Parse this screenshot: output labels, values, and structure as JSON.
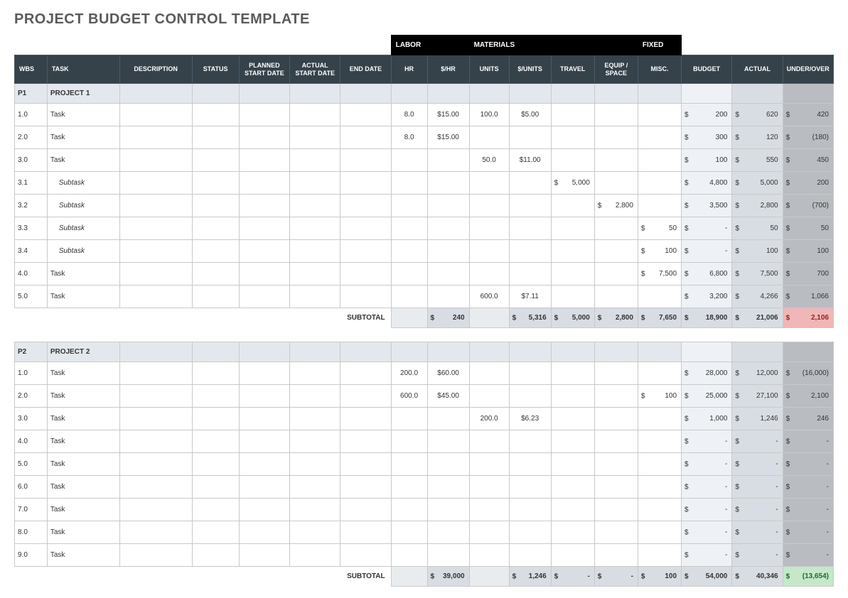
{
  "title": "PROJECT BUDGET CONTROL TEMPLATE",
  "cat": {
    "labor": "LABOR",
    "materials": "MATERIALS",
    "fixed": "FIXED"
  },
  "headers": {
    "wbs": "WBS",
    "task": "TASK",
    "description": "DESCRIPTION",
    "status": "STATUS",
    "pstart": "PLANNED START DATE",
    "astart": "ACTUAL START DATE",
    "end": "END DATE",
    "hr": "HR",
    "rhr": "$/HR",
    "units": "UNITS",
    "runits": "$/UNITS",
    "travel": "TRAVEL",
    "equip": "EQUIP / SPACE",
    "misc": "MISC.",
    "budget": "BUDGET",
    "actual": "ACTUAL",
    "uo": "UNDER/OVER"
  },
  "subtotalLabel": "SUBTOTAL",
  "dollarSign": "$",
  "projects": [
    {
      "id": "P1",
      "name": "PROJECT 1",
      "rows": [
        {
          "wbs": "1.0",
          "task": "Task",
          "hr": "8.0",
          "rhr": "$15.00",
          "units": "100.0",
          "runits": "$5.00",
          "travel": "",
          "equip": "",
          "misc": "",
          "budget": "200",
          "actual": "620",
          "uo": "420"
        },
        {
          "wbs": "2.0",
          "task": "Task",
          "hr": "8.0",
          "rhr": "$15.00",
          "units": "",
          "runits": "",
          "travel": "",
          "equip": "",
          "misc": "",
          "budget": "300",
          "actual": "120",
          "uo": "(180)"
        },
        {
          "wbs": "3.0",
          "task": "Task",
          "hr": "",
          "rhr": "",
          "units": "50.0",
          "runits": "$11.00",
          "travel": "",
          "equip": "",
          "misc": "",
          "budget": "100",
          "actual": "550",
          "uo": "450"
        },
        {
          "wbs": "3.1",
          "task": "Subtask",
          "sub": true,
          "hr": "",
          "rhr": "",
          "units": "",
          "runits": "",
          "travel": "5,000",
          "equip": "",
          "misc": "",
          "budget": "4,800",
          "actual": "5,000",
          "uo": "200"
        },
        {
          "wbs": "3.2",
          "task": "Subtask",
          "sub": true,
          "hr": "",
          "rhr": "",
          "units": "",
          "runits": "",
          "travel": "",
          "equip": "2,800",
          "misc": "",
          "budget": "3,500",
          "actual": "2,800",
          "uo": "(700)"
        },
        {
          "wbs": "3.3",
          "task": "Subtask",
          "sub": true,
          "hr": "",
          "rhr": "",
          "units": "",
          "runits": "",
          "travel": "",
          "equip": "",
          "misc": "50",
          "budget": "-",
          "actual": "50",
          "uo": "50"
        },
        {
          "wbs": "3.4",
          "task": "Subtask",
          "sub": true,
          "hr": "",
          "rhr": "",
          "units": "",
          "runits": "",
          "travel": "",
          "equip": "",
          "misc": "100",
          "budget": "-",
          "actual": "100",
          "uo": "100"
        },
        {
          "wbs": "4.0",
          "task": "Task",
          "hr": "",
          "rhr": "",
          "units": "",
          "runits": "",
          "travel": "",
          "equip": "",
          "misc": "7,500",
          "budget": "6,800",
          "actual": "7,500",
          "uo": "700"
        },
        {
          "wbs": "5.0",
          "task": "Task",
          "hr": "",
          "rhr": "",
          "units": "600.0",
          "runits": "$7.11",
          "travel": "",
          "equip": "",
          "misc": "",
          "budget": "3,200",
          "actual": "4,266",
          "uo": "1,066"
        }
      ],
      "subtotal": {
        "rhr": "240",
        "runits": "5,316",
        "travel": "5,000",
        "equip": "2,800",
        "misc": "7,650",
        "budget": "18,900",
        "actual": "21,006",
        "uo": "2,106",
        "uoClass": "red"
      }
    },
    {
      "id": "P2",
      "name": "PROJECT 2",
      "rows": [
        {
          "wbs": "1.0",
          "task": "Task",
          "hr": "200.0",
          "rhr": "$60.00",
          "units": "",
          "runits": "",
          "travel": "",
          "equip": "",
          "misc": "",
          "budget": "28,000",
          "actual": "12,000",
          "uo": "(16,000)"
        },
        {
          "wbs": "2.0",
          "task": "Task",
          "hr": "600.0",
          "rhr": "$45.00",
          "units": "",
          "runits": "",
          "travel": "",
          "equip": "",
          "misc": "100",
          "budget": "25,000",
          "actual": "27,100",
          "uo": "2,100"
        },
        {
          "wbs": "3.0",
          "task": "Task",
          "hr": "",
          "rhr": "",
          "units": "200.0",
          "runits": "$6.23",
          "travel": "",
          "equip": "",
          "misc": "",
          "budget": "1,000",
          "actual": "1,246",
          "uo": "246"
        },
        {
          "wbs": "4.0",
          "task": "Task",
          "hr": "",
          "rhr": "",
          "units": "",
          "runits": "",
          "travel": "",
          "equip": "",
          "misc": "",
          "budget": "-",
          "actual": "-",
          "uo": "-"
        },
        {
          "wbs": "5.0",
          "task": "Task",
          "hr": "",
          "rhr": "",
          "units": "",
          "runits": "",
          "travel": "",
          "equip": "",
          "misc": "",
          "budget": "-",
          "actual": "-",
          "uo": "-"
        },
        {
          "wbs": "6.0",
          "task": "Task",
          "hr": "",
          "rhr": "",
          "units": "",
          "runits": "",
          "travel": "",
          "equip": "",
          "misc": "",
          "budget": "-",
          "actual": "-",
          "uo": "-"
        },
        {
          "wbs": "7.0",
          "task": "Task",
          "hr": "",
          "rhr": "",
          "units": "",
          "runits": "",
          "travel": "",
          "equip": "",
          "misc": "",
          "budget": "-",
          "actual": "-",
          "uo": "-"
        },
        {
          "wbs": "8.0",
          "task": "Task",
          "hr": "",
          "rhr": "",
          "units": "",
          "runits": "",
          "travel": "",
          "equip": "",
          "misc": "",
          "budget": "-",
          "actual": "-",
          "uo": "-"
        },
        {
          "wbs": "9.0",
          "task": "Task",
          "hr": "",
          "rhr": "",
          "units": "",
          "runits": "",
          "travel": "",
          "equip": "",
          "misc": "",
          "budget": "-",
          "actual": "-",
          "uo": "-"
        }
      ],
      "subtotal": {
        "rhr": "39,000",
        "runits": "1,246",
        "travel": "-",
        "equip": "-",
        "misc": "100",
        "budget": "54,000",
        "actual": "40,346",
        "uo": "(13,654)",
        "uoClass": "green"
      }
    }
  ]
}
